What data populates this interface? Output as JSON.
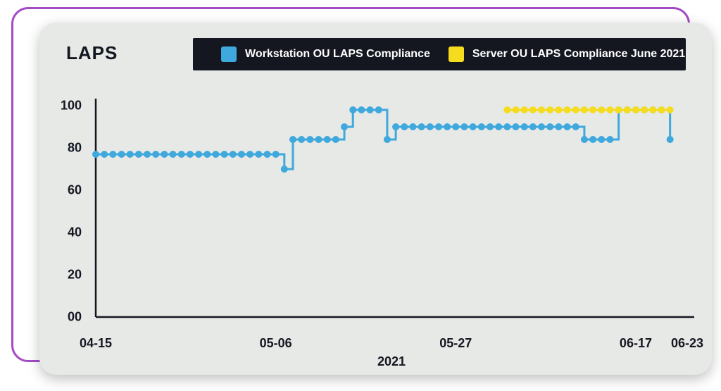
{
  "title": "LAPS",
  "legend": {
    "s1": {
      "label": "Workstation OU LAPS Compliance",
      "color": "#3fa8dc"
    },
    "s2": {
      "label": "Server OU LAPS Compliance June 2021",
      "color": "#f6dc1e"
    }
  },
  "axes": {
    "y_ticks": [
      "00",
      "20",
      "40",
      "60",
      "80",
      "100"
    ],
    "x_ticks": [
      {
        "day": 0,
        "label": "04-15"
      },
      {
        "day": 21,
        "label": "05-06"
      },
      {
        "day": 42,
        "label": "05-27"
      },
      {
        "day": 63,
        "label": "06-17"
      },
      {
        "day": 69,
        "label": "06-23"
      }
    ],
    "x_title": "2021"
  },
  "chart_data": {
    "type": "line",
    "title": "LAPS",
    "xlabel": "2021",
    "ylabel": "",
    "ylim": [
      0,
      100
    ],
    "x_range_days": [
      0,
      69
    ],
    "series": [
      {
        "name": "Workstation OU LAPS Compliance",
        "color": "#3fa8dc",
        "points": [
          {
            "day": 0,
            "y": 77
          },
          {
            "day": 1,
            "y": 77
          },
          {
            "day": 2,
            "y": 77
          },
          {
            "day": 3,
            "y": 77
          },
          {
            "day": 4,
            "y": 77
          },
          {
            "day": 5,
            "y": 77
          },
          {
            "day": 6,
            "y": 77
          },
          {
            "day": 7,
            "y": 77
          },
          {
            "day": 8,
            "y": 77
          },
          {
            "day": 9,
            "y": 77
          },
          {
            "day": 10,
            "y": 77
          },
          {
            "day": 11,
            "y": 77
          },
          {
            "day": 12,
            "y": 77
          },
          {
            "day": 13,
            "y": 77
          },
          {
            "day": 14,
            "y": 77
          },
          {
            "day": 15,
            "y": 77
          },
          {
            "day": 16,
            "y": 77
          },
          {
            "day": 17,
            "y": 77
          },
          {
            "day": 18,
            "y": 77
          },
          {
            "day": 19,
            "y": 77
          },
          {
            "day": 20,
            "y": 77
          },
          {
            "day": 21,
            "y": 77
          },
          {
            "day": 22,
            "y": 70
          },
          {
            "day": 23,
            "y": 84
          },
          {
            "day": 24,
            "y": 84
          },
          {
            "day": 25,
            "y": 84
          },
          {
            "day": 26,
            "y": 84
          },
          {
            "day": 27,
            "y": 84
          },
          {
            "day": 28,
            "y": 84
          },
          {
            "day": 29,
            "y": 90
          },
          {
            "day": 30,
            "y": 98
          },
          {
            "day": 31,
            "y": 98
          },
          {
            "day": 32,
            "y": 98
          },
          {
            "day": 33,
            "y": 98
          },
          {
            "day": 34,
            "y": 84
          },
          {
            "day": 35,
            "y": 90
          },
          {
            "day": 36,
            "y": 90
          },
          {
            "day": 37,
            "y": 90
          },
          {
            "day": 38,
            "y": 90
          },
          {
            "day": 39,
            "y": 90
          },
          {
            "day": 40,
            "y": 90
          },
          {
            "day": 41,
            "y": 90
          },
          {
            "day": 42,
            "y": 90
          },
          {
            "day": 43,
            "y": 90
          },
          {
            "day": 44,
            "y": 90
          },
          {
            "day": 45,
            "y": 90
          },
          {
            "day": 46,
            "y": 90
          },
          {
            "day": 47,
            "y": 90
          },
          {
            "day": 48,
            "y": 90
          },
          {
            "day": 49,
            "y": 90
          },
          {
            "day": 50,
            "y": 90
          },
          {
            "day": 51,
            "y": 90
          },
          {
            "day": 52,
            "y": 90
          },
          {
            "day": 53,
            "y": 90
          },
          {
            "day": 54,
            "y": 90
          },
          {
            "day": 55,
            "y": 90
          },
          {
            "day": 56,
            "y": 90
          },
          {
            "day": 57,
            "y": 84
          },
          {
            "day": 58,
            "y": 84
          },
          {
            "day": 59,
            "y": 84
          },
          {
            "day": 60,
            "y": 84
          },
          {
            "day": 61,
            "y": 98
          },
          {
            "day": 62,
            "y": 98
          },
          {
            "day": 63,
            "y": 98
          },
          {
            "day": 64,
            "y": 98
          },
          {
            "day": 65,
            "y": 98
          },
          {
            "day": 66,
            "y": 98
          },
          {
            "day": 67,
            "y": 84
          }
        ]
      },
      {
        "name": "Server OU LAPS Compliance June 2021",
        "color": "#f6dc1e",
        "points": [
          {
            "day": 48,
            "y": 98
          },
          {
            "day": 49,
            "y": 98
          },
          {
            "day": 50,
            "y": 98
          },
          {
            "day": 51,
            "y": 98
          },
          {
            "day": 52,
            "y": 98
          },
          {
            "day": 53,
            "y": 98
          },
          {
            "day": 54,
            "y": 98
          },
          {
            "day": 55,
            "y": 98
          },
          {
            "day": 56,
            "y": 98
          },
          {
            "day": 57,
            "y": 98
          },
          {
            "day": 58,
            "y": 98
          },
          {
            "day": 59,
            "y": 98
          },
          {
            "day": 60,
            "y": 98
          },
          {
            "day": 61,
            "y": 98
          },
          {
            "day": 62,
            "y": 98
          },
          {
            "day": 63,
            "y": 98
          },
          {
            "day": 64,
            "y": 98
          },
          {
            "day": 65,
            "y": 98
          },
          {
            "day": 66,
            "y": 98
          },
          {
            "day": 67,
            "y": 98
          }
        ]
      }
    ]
  }
}
